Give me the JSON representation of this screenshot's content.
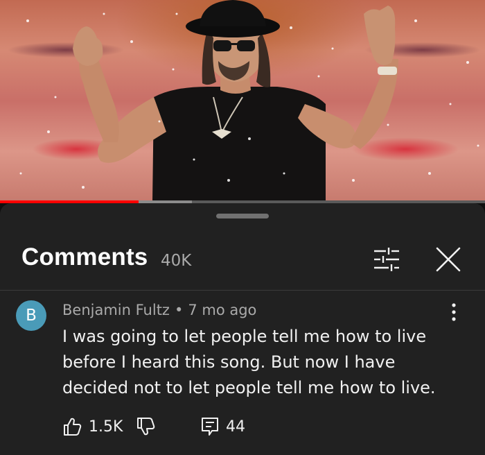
{
  "video": {
    "progress_fraction": 0.285,
    "buffer_end_fraction": 0.395
  },
  "panel": {
    "title": "Comments",
    "count": "40K"
  },
  "icons": {
    "filter": "sliders-icon",
    "close": "close-icon",
    "more": "more-vertical-icon",
    "like": "thumbs-up-icon",
    "dislike": "thumbs-down-icon",
    "reply": "reply-icon"
  },
  "comment": {
    "avatar_letter": "B",
    "avatar_color": "#4a9bb8",
    "author": "Benjamin Fultz",
    "separator": "•",
    "time_ago": "7 mo ago",
    "lines": [
      "I was going to let people tell me how to live",
      "before I heard this song. But now I have",
      "decided not to let people tell me how to live."
    ],
    "likes": "1.5K",
    "replies": "44"
  },
  "colors": {
    "sheet_bg": "#212121",
    "progress_red": "#ff0000",
    "muted_text": "#aaaaaa"
  }
}
